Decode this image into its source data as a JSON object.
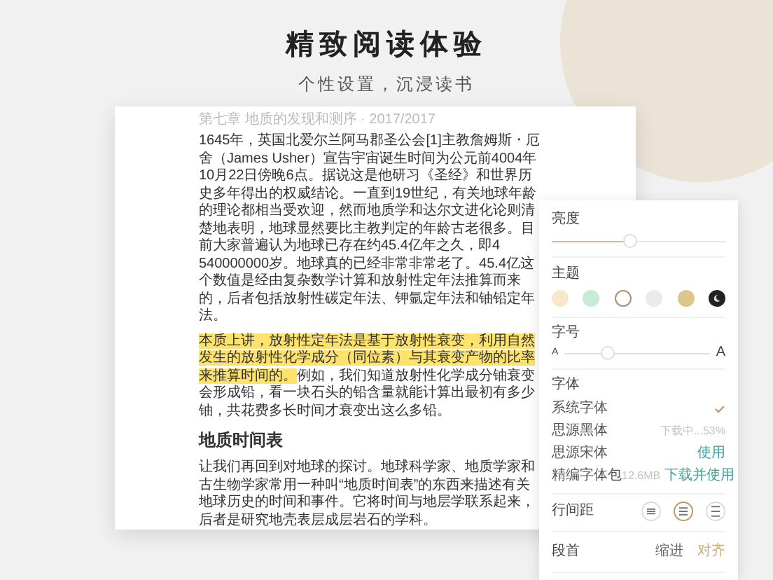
{
  "header": {
    "title": "精致阅读体验",
    "subtitle": "个性设置，沉浸读书"
  },
  "document": {
    "meta": "第七章 地质的发现和测序 · 2017/2017",
    "paragraphs": [
      {
        "kind": "text",
        "segments": [
          {
            "text": "1645年，英国北爱尔兰阿马郡圣公会[1]主教詹姆斯・厄舍（James Usher）宣告宇宙诞生时间为公元前4004年10月22日傍晚6点。据说这是他研习《圣经》和世界历史多年得出的权威结论。一直到19世纪，有关地球年龄的理论都相当受欢迎，然而地质学和达尔文进化论则清楚地表明，地球显然要比主教判定的年龄古老很多。目前大家普遍认为地球已存在约45.4亿年之久，即4 540000000岁。地球真的已经非常非常老了。45.4亿这个数值是经由复杂数学计算和放射性定年法推算而来的，后者包括放射性碳定年法、钾氩定年法和铀铅定年法。",
            "highlighted": false
          }
        ]
      },
      {
        "kind": "text",
        "segments": [
          {
            "text": "本质上讲，放射性定年法是基于放射性衰变，利用自然发生的放射性化学成分（同位素）与其衰变产物的比率来推算时间的。",
            "highlighted": true
          },
          {
            "text": "例如，我们知道放射性化学成分铀衰变会形成铅，看一块石头的铅含量就能计算出最初有多少铀，共花费多长时间才衰变出这么多铅。",
            "highlighted": false
          }
        ]
      },
      {
        "kind": "heading",
        "segments": [
          {
            "text": "地质时间表",
            "highlighted": false
          }
        ]
      },
      {
        "kind": "text",
        "segments": [
          {
            "text": "让我们再回到对地球的探讨。地球科学家、地质学家和古生物学家常用一种叫“地质时间表”的东西来描述有关地球历史的时间和事件。它将时间与地层学联系起来，后者是研究地壳表层成层岩石的学科。",
            "highlighted": false
          }
        ]
      }
    ]
  },
  "settings": {
    "brightness": {
      "label": "亮度",
      "level": 0.45
    },
    "theme": {
      "label": "主题",
      "swatches": [
        {
          "color": "#f6e8c9",
          "selected": false,
          "kind": "plain"
        },
        {
          "color": "#c9ead4",
          "selected": false,
          "kind": "plain"
        },
        {
          "color": "#ffffff",
          "selected": true,
          "kind": "plain"
        },
        {
          "color": "#eaeaea",
          "selected": false,
          "kind": "plain"
        },
        {
          "color": "#dcc68c",
          "selected": false,
          "kind": "plain"
        },
        {
          "color": "#222222",
          "selected": false,
          "kind": "night"
        }
      ]
    },
    "font_size": {
      "label": "字号",
      "small_glyph": "A",
      "large_glyph": "A",
      "level": 0.3
    },
    "fonts": {
      "label": "字体",
      "items": [
        {
          "name": "系统字体",
          "selected": true
        },
        {
          "name": "思源黑体",
          "selected": false,
          "note": "下载中...53%"
        },
        {
          "name": "思源宋体",
          "selected": false,
          "action": "使用"
        },
        {
          "name": "精编字体包",
          "selected": false,
          "note": "12.6MB",
          "action": "下载并使用"
        }
      ]
    },
    "line_spacing": {
      "label": "行间距",
      "options": [
        {
          "kind": "compact",
          "selected": false
        },
        {
          "kind": "medium",
          "selected": true
        },
        {
          "kind": "loose",
          "selected": false
        }
      ]
    },
    "paragraph": {
      "label": "段首",
      "options": [
        {
          "label": "缩进",
          "selected": false
        },
        {
          "label": "对齐",
          "selected": true
        }
      ]
    }
  }
}
